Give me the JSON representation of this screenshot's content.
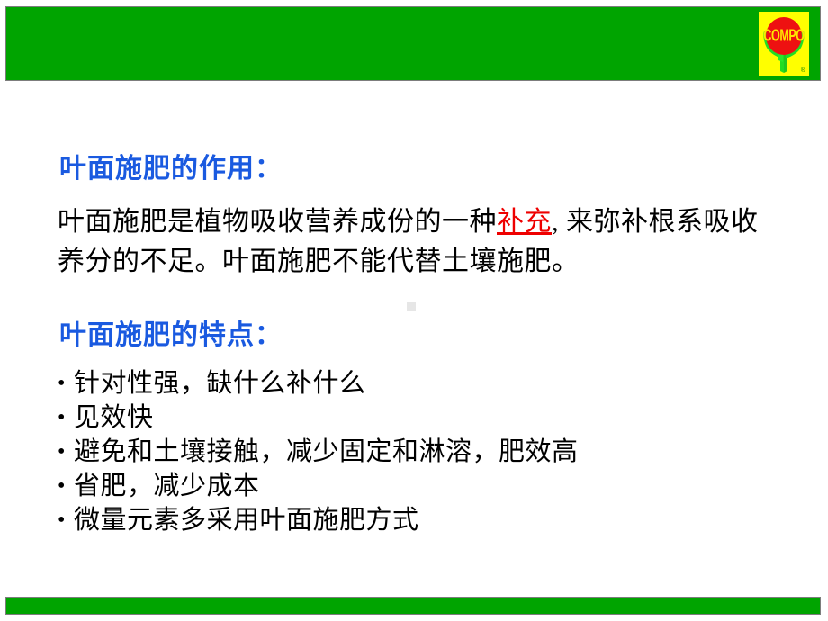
{
  "slide": {
    "background_color": "#ffffff",
    "banner_color": "#00a400",
    "banner_border_color": "#7d7d7d",
    "heading_color": "#1a5ae0",
    "emphasis_color": "#ee0000"
  },
  "logo": {
    "wordmark": "COMPO",
    "registered_mark": "®",
    "plate_color": "#ffff00",
    "ellipse_color": "#ee1111",
    "flower_color": "#22dd22",
    "word_color": "#ffe600"
  },
  "content": {
    "heading_1": "叶面施肥的作用：",
    "paragraph": {
      "before": "叶面施肥是植物吸收营养成份的一种",
      "emphasis": "补充",
      "after": ", 来弥补根系吸收养分的不足。叶面施肥不能代替土壤施肥。"
    },
    "heading_2": "叶面施肥的特点：",
    "bullet_marker": "•",
    "bullets": [
      "针对性强，缺什么补什么",
      "见效快",
      "避免和土壤接触，减少固定和淋溶，肥效高",
      "省肥，减少成本",
      "微量元素多采用叶面施肥方式"
    ]
  }
}
